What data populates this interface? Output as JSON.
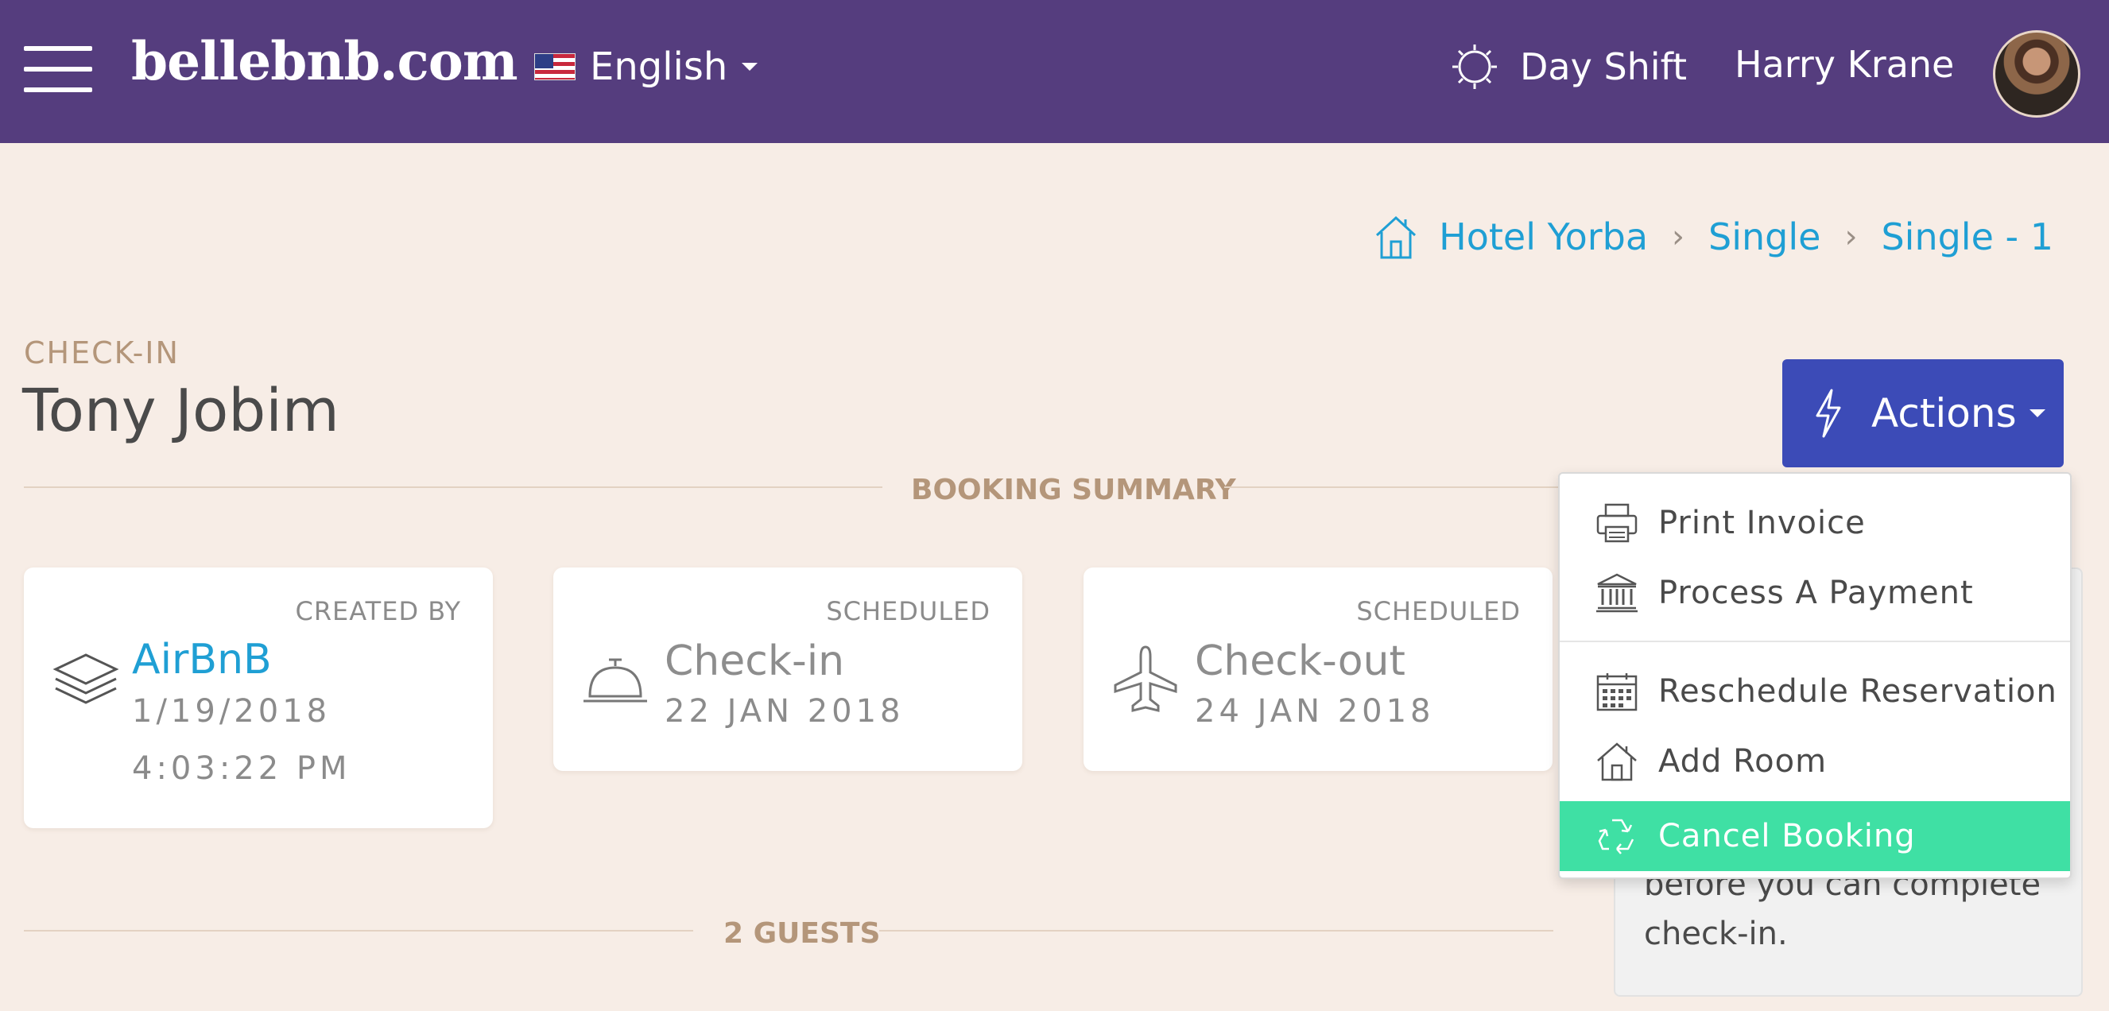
{
  "header": {
    "logo": "bellebnb.com",
    "language": "English",
    "shift": "Day Shift",
    "user_name": "Harry Krane"
  },
  "breadcrumb": {
    "items": [
      "Hotel Yorba",
      "Single",
      "Single - 1"
    ]
  },
  "page": {
    "eyebrow": "CHECK-IN",
    "title": "Tony Jobim"
  },
  "actions": {
    "label": "Actions",
    "items": [
      {
        "label": "Print Invoice",
        "icon": "printer-icon"
      },
      {
        "label": "Process A Payment",
        "icon": "bank-icon"
      },
      {
        "label": "Reschedule Reservation",
        "icon": "calendar-icon"
      },
      {
        "label": "Add Room",
        "icon": "house-icon"
      },
      {
        "label": "Cancel Booking",
        "icon": "recycle-icon"
      }
    ]
  },
  "sections": {
    "booking_summary": "BOOKING SUMMARY",
    "guests": "2 GUESTS"
  },
  "cards": [
    {
      "label": "CREATED BY",
      "title": "AirBnB",
      "line1": "1/19/2018",
      "line2": "4:03:22 PM",
      "icon": "layers-icon"
    },
    {
      "label": "SCHEDULED",
      "title": "Check-in",
      "line1": "22 JAN 2018",
      "icon": "bell-icon"
    },
    {
      "label": "SCHEDULED",
      "title": "Check-out",
      "line1": "24 JAN 2018",
      "icon": "airplane-icon"
    }
  ],
  "info_panel": {
    "text": "before you can complete check-in."
  },
  "colors": {
    "header_bg": "#553d7e",
    "page_bg": "#f7ede6",
    "accent_blue": "#3c4bb7",
    "link_blue": "#1f9fd4",
    "highlight_green": "#3fe0a4",
    "label_tan": "#b4967a"
  }
}
